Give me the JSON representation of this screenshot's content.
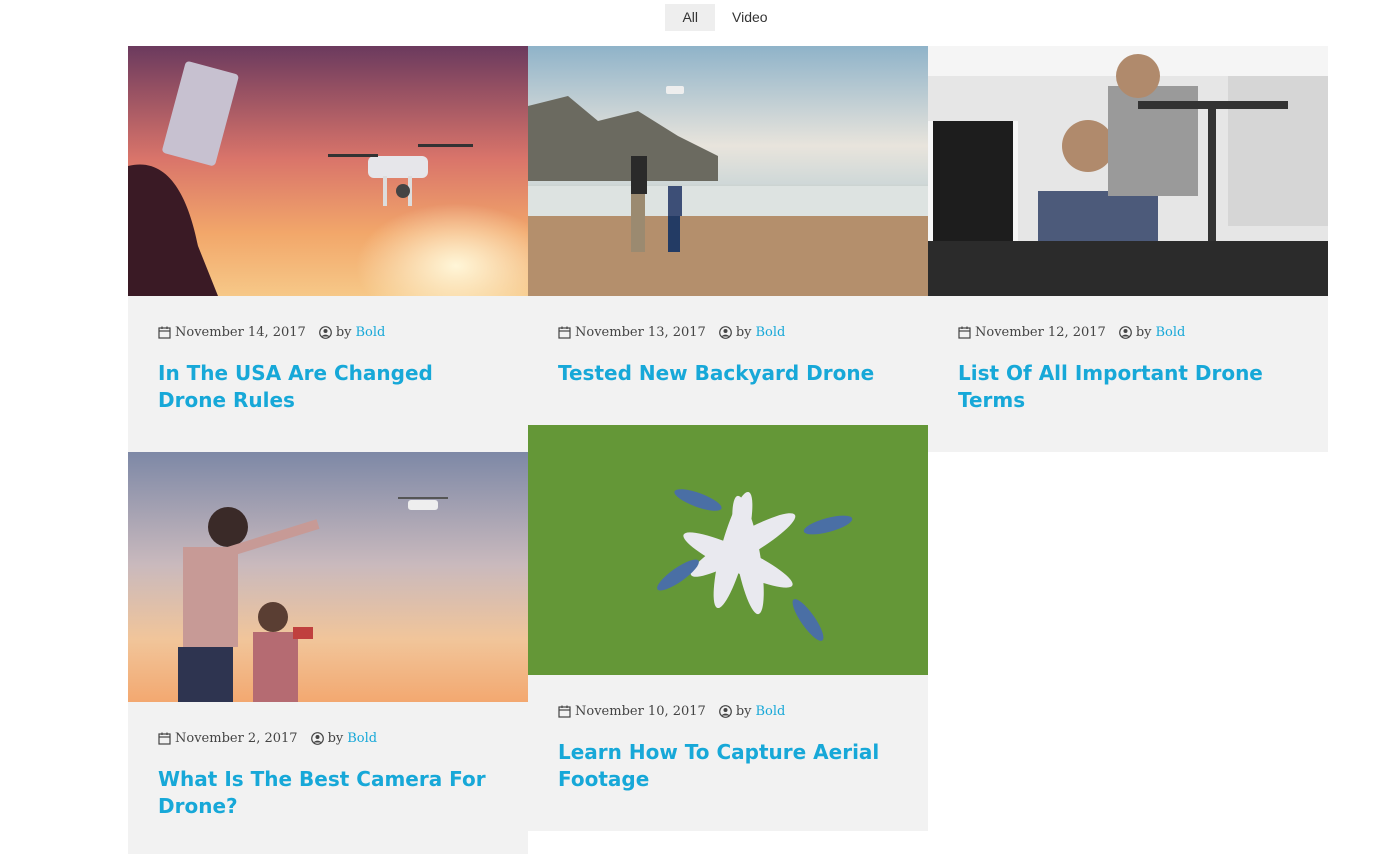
{
  "filters": [
    {
      "label": "All",
      "active": true
    },
    {
      "label": "Video",
      "active": false
    }
  ],
  "posts": [
    {
      "date": "November 14, 2017",
      "by": "by",
      "author": "Bold",
      "title": "In The USA Are Changed Drone Rules",
      "image": "sunset-drone-silhouette-photo"
    },
    {
      "date": "November 13, 2017",
      "by": "by",
      "author": "Bold",
      "title": "Tested New Backyard Drone",
      "image": "beach-family-drone-photo"
    },
    {
      "date": "November 12, 2017",
      "by": "by",
      "author": "Bold",
      "title": "List Of All Important Drone Terms",
      "image": "workshop-drone-build-photo"
    },
    {
      "date": "November 2, 2017",
      "by": "by",
      "author": "Bold",
      "title": "What Is The Best Camera For Drone?",
      "image": "mother-daughter-drone-photo"
    },
    {
      "date": "November 10, 2017",
      "by": "by",
      "author": "Bold",
      "title": "Learn How To Capture Aerial Footage",
      "image": "aerial-group-grass-photo"
    }
  ],
  "colors": {
    "accent": "#17a8d8",
    "card_bg": "#f2f2f2"
  }
}
